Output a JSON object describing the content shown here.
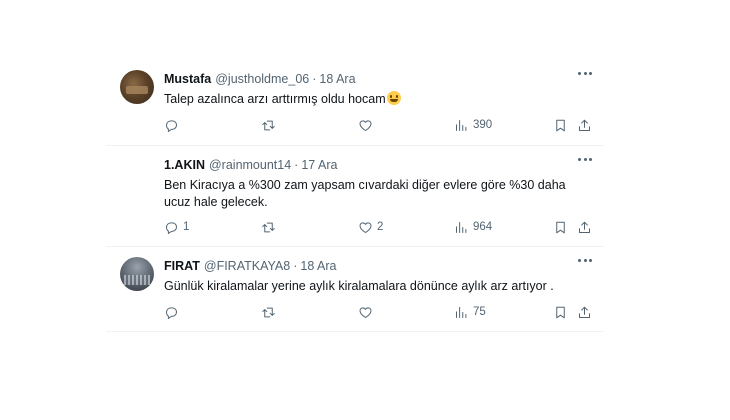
{
  "tweets": [
    {
      "name": "Mustafa",
      "handle": "@justholdme_06",
      "separator": "·",
      "date": "18 Ara",
      "text": "Talep azalınca arzı arttırmış oldu hocam",
      "has_emoji": true,
      "replies": "",
      "retweets": "",
      "likes": "",
      "views": "390"
    },
    {
      "name": "1.AKIN",
      "handle": "@rainmount14",
      "separator": "·",
      "date": "17 Ara",
      "text": "Ben Kiracıya a %300 zam yapsam cıvardaki diğer evlere göre %30 daha ucuz hale gelecek.",
      "has_emoji": false,
      "replies": "1",
      "retweets": "",
      "likes": "2",
      "views": "964"
    },
    {
      "name": "FIRAT",
      "handle": "@FIRATKAYA8",
      "separator": "·",
      "date": "18 Ara",
      "text": "Günlük kiralamalar yerine aylık kiralamalara dönünce aylık arz artıyor .",
      "has_emoji": false,
      "replies": "",
      "retweets": "",
      "likes": "",
      "views": "75"
    }
  ],
  "icons": {
    "reply": "reply-icon",
    "retweet": "retweet-icon",
    "like": "heart-icon",
    "views": "views-icon",
    "bookmark": "bookmark-icon",
    "share": "share-icon",
    "more": "more-icon"
  },
  "colors": {
    "text": "#0f1419",
    "secondary": "#536471",
    "divider": "#eff3f4"
  }
}
